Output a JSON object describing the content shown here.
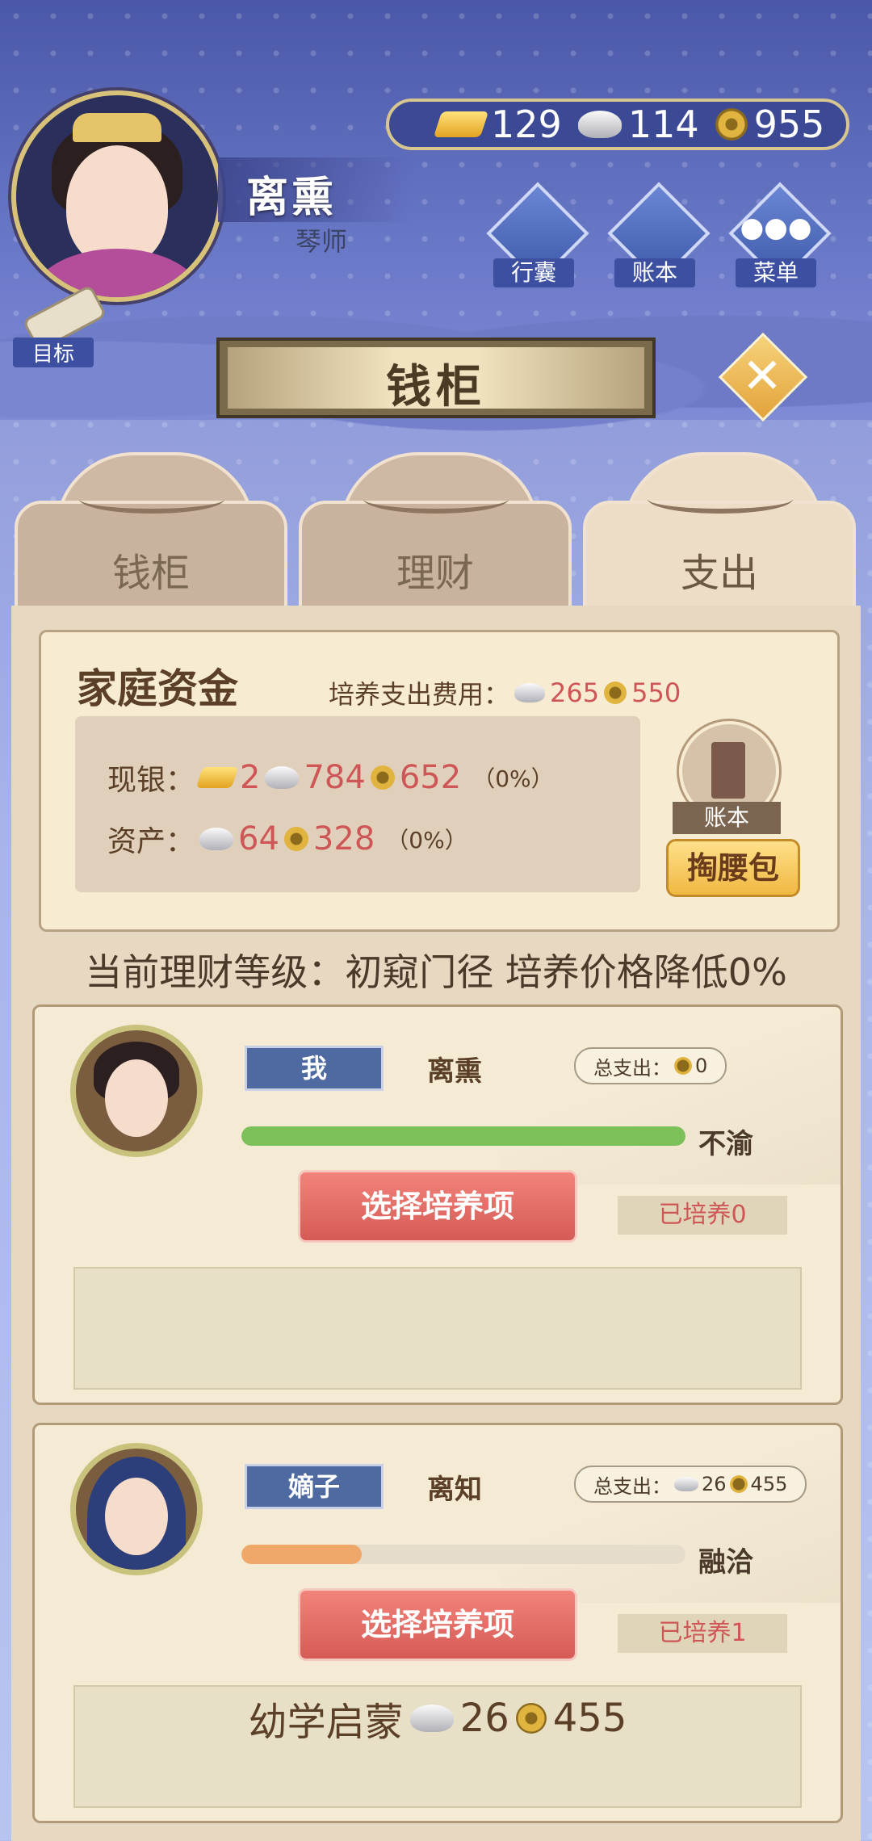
{
  "player": {
    "name": "离熏",
    "title": "琴师"
  },
  "currency": {
    "gold": "129",
    "silver": "114",
    "coin": "955"
  },
  "top_buttons": [
    {
      "label": "行囊",
      "icon": "bag-icon"
    },
    {
      "label": "账本",
      "icon": "ledger-icon"
    },
    {
      "label": "菜单",
      "icon": "more-icon"
    }
  ],
  "goal": {
    "label": "目标"
  },
  "banner": {
    "title": "钱柜"
  },
  "tabs": [
    {
      "label": "钱柜",
      "active": false
    },
    {
      "label": "理财",
      "active": false
    },
    {
      "label": "支出",
      "active": true
    }
  ],
  "fund": {
    "title": "家庭资金",
    "cost_label": "培养支出费用：",
    "cost_silver": "265",
    "cost_coin": "550",
    "cash_label": "现银：",
    "cash_gold": "2",
    "cash_silver": "784",
    "cash_coin": "652",
    "cash_pct": "（0%）",
    "assets_label": "资产：",
    "assets_silver": "64",
    "assets_coin": "328",
    "assets_pct": "（0%）",
    "ledger_label": "账本",
    "purse_button": "掏腰包"
  },
  "level_text": "当前理财等级：初窥门径 培养价格降低0%",
  "members": [
    {
      "role": "我",
      "name": "离熏",
      "spent_label": "总支出：",
      "spent_silver": "",
      "spent_coin": "0",
      "relation_progress": 1.0,
      "relation_color": "#7cc05a",
      "relation": "不渝",
      "select_button": "选择培养项",
      "trained": "已培养0",
      "entries": []
    },
    {
      "role": "嫡子",
      "name": "离知",
      "spent_label": "总支出：",
      "spent_silver": "26",
      "spent_coin": "455",
      "relation_progress": 0.27,
      "relation_color": "#f0a86a",
      "relation": "融洽",
      "select_button": "选择培养项",
      "trained": "已培养1",
      "entries": [
        {
          "name": "幼学启蒙",
          "silver": "26",
          "coin": "455"
        }
      ]
    }
  ]
}
